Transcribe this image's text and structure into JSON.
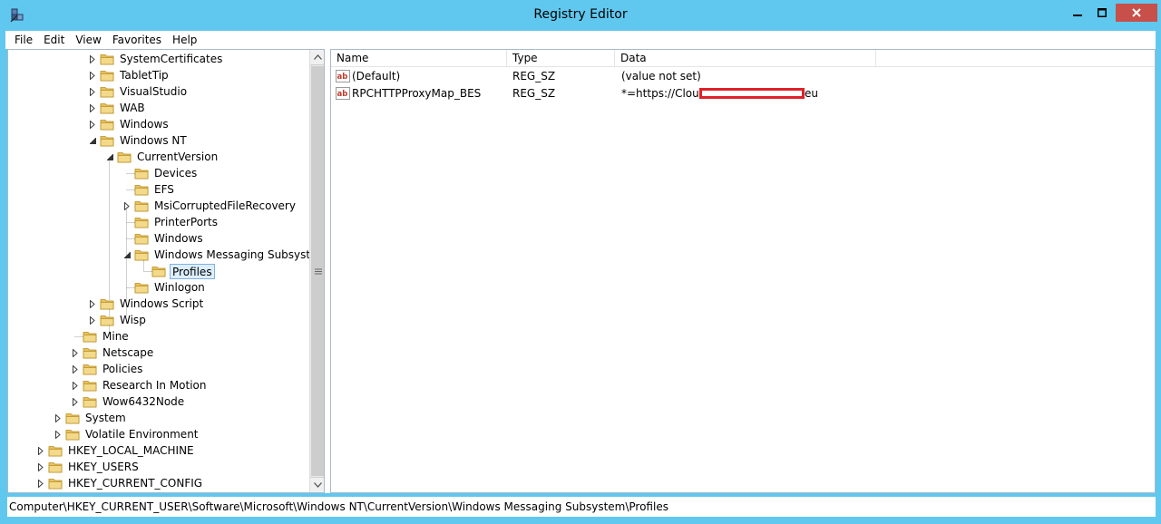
{
  "window": {
    "title": "Registry Editor"
  },
  "menu": [
    "File",
    "Edit",
    "View",
    "Favorites",
    "Help"
  ],
  "tree": [
    {
      "label": "SystemCertificates",
      "expander": "collapsed"
    },
    {
      "label": "TabletTip",
      "expander": "collapsed"
    },
    {
      "label": "VisualStudio",
      "expander": "collapsed"
    },
    {
      "label": "WAB",
      "expander": "collapsed"
    },
    {
      "label": "Windows",
      "expander": "collapsed"
    },
    {
      "label": "Windows NT",
      "expander": "expanded"
    },
    {
      "label": "CurrentVersion",
      "expander": "expanded"
    },
    {
      "label": "Devices",
      "expander": "none"
    },
    {
      "label": "EFS",
      "expander": "none"
    },
    {
      "label": "MsiCorruptedFileRecovery",
      "expander": "collapsed"
    },
    {
      "label": "PrinterPorts",
      "expander": "none"
    },
    {
      "label": "Windows",
      "expander": "none"
    },
    {
      "label": "Windows Messaging Subsystem",
      "expander": "expanded"
    },
    {
      "label": "Profiles",
      "expander": "none",
      "selected": true
    },
    {
      "label": "Winlogon",
      "expander": "none"
    },
    {
      "label": "Windows Script",
      "expander": "collapsed"
    },
    {
      "label": "Wisp",
      "expander": "collapsed"
    },
    {
      "label": "Mine",
      "expander": "none"
    },
    {
      "label": "Netscape",
      "expander": "collapsed"
    },
    {
      "label": "Policies",
      "expander": "collapsed"
    },
    {
      "label": "Research In Motion",
      "expander": "collapsed"
    },
    {
      "label": "Wow6432Node",
      "expander": "collapsed"
    },
    {
      "label": "System",
      "expander": "collapsed"
    },
    {
      "label": "Volatile Environment",
      "expander": "collapsed"
    },
    {
      "label": "HKEY_LOCAL_MACHINE",
      "expander": "collapsed"
    },
    {
      "label": "HKEY_USERS",
      "expander": "collapsed"
    },
    {
      "label": "HKEY_CURRENT_CONFIG",
      "expander": "collapsed"
    }
  ],
  "values": {
    "columns": [
      "Name",
      "Type",
      "Data"
    ],
    "rows": [
      {
        "name": "(Default)",
        "type": "REG_SZ",
        "data_prefix": "(value not set)",
        "data_suffix": "",
        "icon": "string-value-icon",
        "redacted": false
      },
      {
        "name": "RPCHTTPProxyMap_BES",
        "type": "REG_SZ",
        "data_prefix": "*=https://Cloud",
        "data_suffix": "eu",
        "icon": "string-value-icon",
        "redacted": true
      }
    ]
  },
  "statusbar": {
    "path": "Computer\\HKEY_CURRENT_USER\\Software\\Microsoft\\Windows NT\\CurrentVersion\\Windows Messaging Subsystem\\Profiles"
  },
  "colors": {
    "titlebar": "#60c8ee",
    "close_button": "#c7504a",
    "selection": "#dceeff",
    "redaction": "#e0202a",
    "folder": "#e8c25a"
  }
}
